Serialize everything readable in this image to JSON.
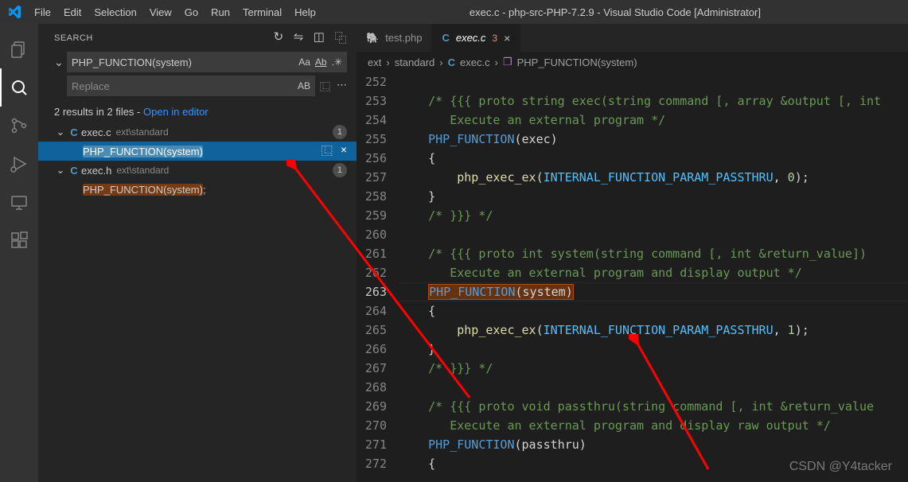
{
  "title": "exec.c - php-src-PHP-7.2.9 - Visual Studio Code [Administrator]",
  "menu": [
    "File",
    "Edit",
    "Selection",
    "View",
    "Go",
    "Run",
    "Terminal",
    "Help"
  ],
  "sidebar": {
    "label": "SEARCH",
    "query": "PHP_FUNCTION(system)",
    "replace_placeholder": "Replace",
    "results_text": "2 results in 2 files - ",
    "open_in_editor": "Open in editor",
    "files": [
      {
        "name": "exec.c",
        "path": "ext\\standard",
        "count": "1",
        "match": "PHP_FUNCTION(system)",
        "selected": true
      },
      {
        "name": "exec.h",
        "path": "ext\\standard",
        "count": "1",
        "match": "PHP_FUNCTION(system);",
        "selected": false
      }
    ]
  },
  "tabs": [
    {
      "icon": "php",
      "glyph": "🐘",
      "label": "test.php",
      "active": false,
      "problems": ""
    },
    {
      "icon": "c",
      "glyph": "C",
      "label": "exec.c",
      "active": true,
      "italic": true,
      "problems": "3",
      "close": true
    }
  ],
  "breadcrumbs": {
    "parts": [
      "ext",
      "standard"
    ],
    "file": "exec.c",
    "symbol": "PHP_FUNCTION(system)"
  },
  "code": {
    "start": 252,
    "current": 263,
    "lines": [
      "",
      "    /* {{{ proto string exec(string command [, array &output [, int",
      "       Execute an external program */",
      "    PHP_FUNCTION(exec)",
      "    {",
      "        php_exec_ex(INTERNAL_FUNCTION_PARAM_PASSTHRU, 0);",
      "    }",
      "    /* }}} */",
      "",
      "    /* {{{ proto int system(string command [, int &return_value])",
      "       Execute an external program and display output */",
      "    PHP_FUNCTION(system)",
      "    {",
      "        php_exec_ex(INTERNAL_FUNCTION_PARAM_PASSTHRU, 1);",
      "    }",
      "    /* }}} */",
      "",
      "    /* {{{ proto void passthru(string command [, int &return_value",
      "       Execute an external program and display raw output */",
      "    PHP_FUNCTION(passthru)",
      "    {"
    ]
  },
  "watermark": "CSDN @Y4tacker"
}
